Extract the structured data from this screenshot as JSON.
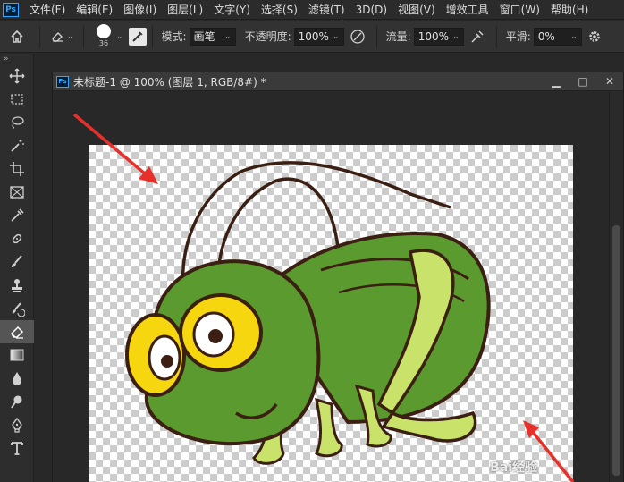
{
  "menubar": {
    "logo": "Ps",
    "items": [
      "文件(F)",
      "编辑(E)",
      "图像(I)",
      "图层(L)",
      "文字(Y)",
      "选择(S)",
      "滤镜(T)",
      "3D(D)",
      "视图(V)",
      "增效工具",
      "窗口(W)",
      "帮助(H)"
    ]
  },
  "options": {
    "brush_size": "36",
    "mode_label": "模式:",
    "mode_value": "画笔",
    "opacity_label": "不透明度:",
    "opacity_value": "100%",
    "flow_label": "流量:",
    "flow_value": "100%",
    "smoothing_label": "平滑:",
    "smoothing_value": "0%"
  },
  "toolbar": {
    "collapse": "»",
    "tools": [
      "move",
      "marquee",
      "lasso",
      "magic-wand",
      "crop",
      "frame",
      "eyedropper",
      "healing",
      "brush",
      "stamp",
      "history-brush",
      "eraser",
      "gradient",
      "blur",
      "dodge",
      "pen",
      "type"
    ]
  },
  "document": {
    "logo": "Ps",
    "title": "未标题-1 @ 100% (图层 1, RGB/8#) *",
    "minimize": "▁",
    "maximize": "□",
    "close": "✕"
  },
  "watermark": "Bai经验",
  "colors": {
    "arrow": "#e8302a",
    "grasshopper_body": "#5b9a2e",
    "grasshopper_leg": "#c9e26a",
    "eye": "#f5d60f",
    "outline": "#3b1f12"
  }
}
